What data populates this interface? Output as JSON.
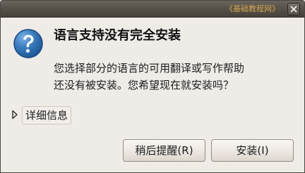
{
  "window": {
    "title": "《基础教程网》"
  },
  "dialog": {
    "heading": "语言支持没有完全安装",
    "message_lines": [
      "您选择部分的语言的可用翻译或写作帮助",
      "还没有被安装。您希望现在就安装吗？"
    ]
  },
  "details": {
    "label": "详细信息"
  },
  "buttons": {
    "later": "稍后提醒(R)",
    "install": "安装(I)"
  },
  "colors": {
    "title_text": "#d4a64f",
    "dialog_background": "#efebe7",
    "question_icon": "#2f6ea8"
  },
  "icons": {
    "dialog": "question-icon",
    "close": "close-icon",
    "expander": "triangle-right-icon"
  }
}
